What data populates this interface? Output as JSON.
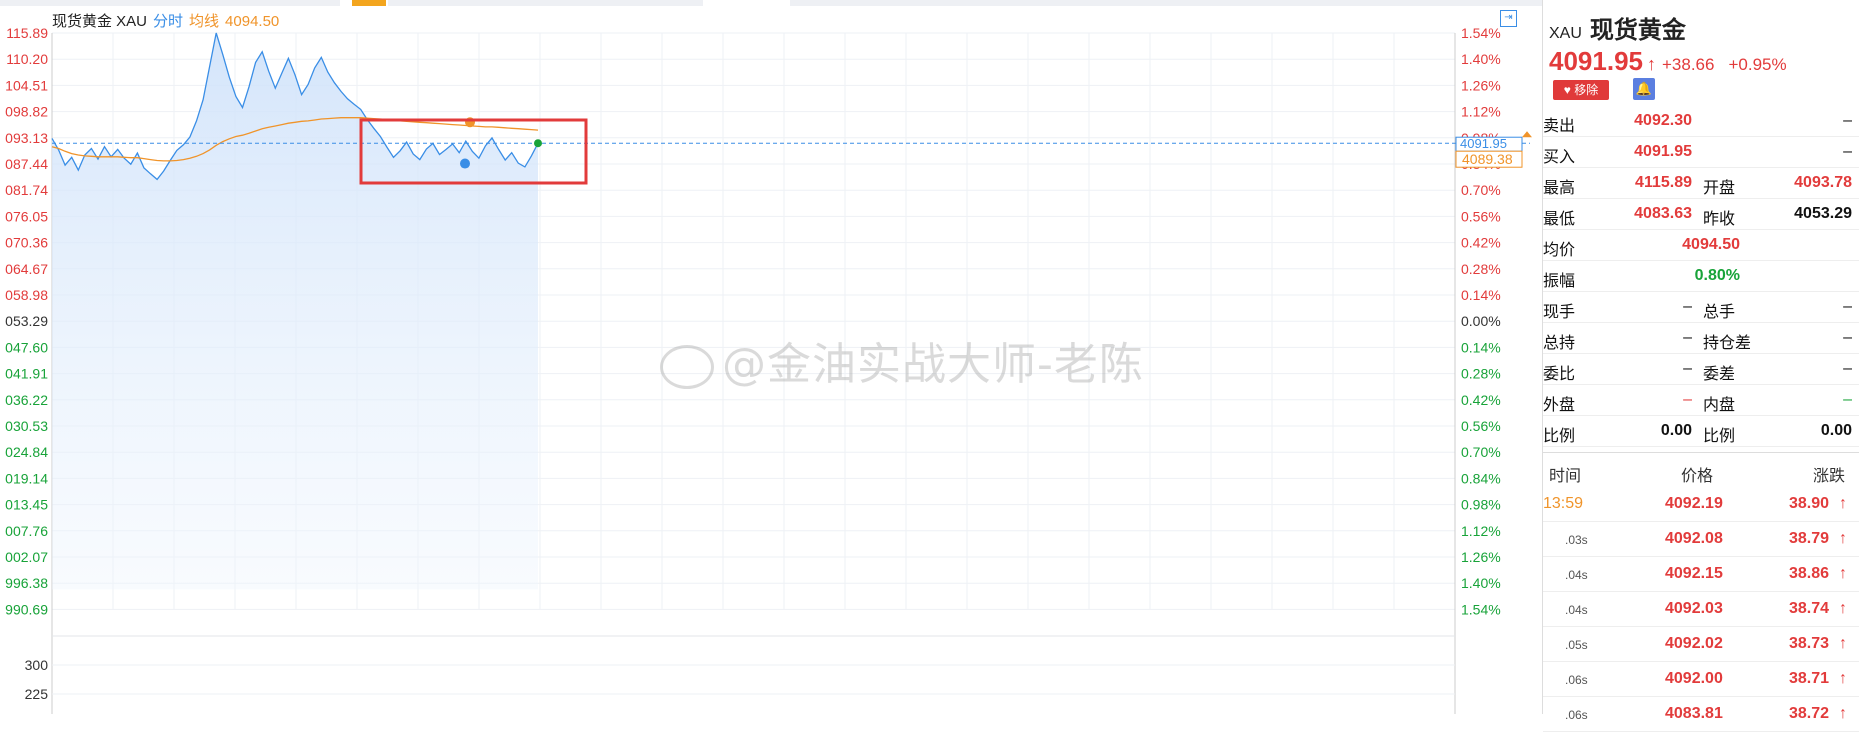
{
  "header": {
    "title": "现货黄金 XAU",
    "mode": "分时",
    "ma_label": "均线",
    "ma_value": "4094.50"
  },
  "chart_data": {
    "type": "line",
    "y_labels_left": [
      "115.89",
      "110.20",
      "104.51",
      "098.82",
      "093.13",
      "087.44",
      "081.74",
      "076.05",
      "070.36",
      "064.67",
      "058.98",
      "053.29",
      "047.60",
      "041.91",
      "036.22",
      "030.53",
      "024.84",
      "019.14",
      "013.45",
      "007.76",
      "002.07",
      "996.38",
      "990.69"
    ],
    "y_labels_right": [
      "1.54%",
      "1.40%",
      "1.26%",
      "1.12%",
      "0.98%",
      "0.84%",
      "0.70%",
      "0.56%",
      "0.42%",
      "0.28%",
      "0.14%",
      "0.00%",
      "0.14%",
      "0.28%",
      "0.42%",
      "0.56%",
      "0.70%",
      "0.84%",
      "0.98%",
      "1.12%",
      "1.26%",
      "1.40%",
      "1.54%"
    ],
    "volume_ticks": [
      "300",
      "225"
    ],
    "ylim": [
      3990.69,
      4115.89
    ],
    "current_price_tag": "4091.95",
    "avg_price_tag": "4089.38",
    "series": [
      {
        "values": [
          4093.0,
          4090.5,
          4087.2,
          4088.9,
          4086.1,
          4089.4,
          4090.8,
          4088.5,
          4091.2,
          4089.0,
          4090.6,
          4088.7,
          4087.4,
          4089.8,
          4086.6,
          4085.3,
          4084.1,
          4085.9,
          4088.2,
          4090.4,
          4091.6,
          4093.3,
          4096.8,
          4101.4,
          4108.6,
          4115.9,
          4111.2,
          4106.3,
          4102.1,
          4099.7,
          4104.2,
          4109.5,
          4111.8,
          4107.6,
          4103.9,
          4107.2,
          4110.4,
          4106.8,
          4102.5,
          4104.7,
          4108.3,
          4110.6,
          4107.4,
          4105.1,
          4103.2,
          4101.6,
          4100.4,
          4099.3,
          4097.1,
          4095.2,
          4093.4,
          4091.1,
          4088.9,
          4090.3,
          4092.2,
          4089.6,
          4088.4,
          4090.7,
          4091.9,
          4089.5,
          4090.6,
          4091.8,
          4089.9,
          4092.4,
          4090.2,
          4088.7,
          4091.4,
          4093.1,
          4090.6,
          4088.3,
          4089.9,
          4087.6,
          4086.8,
          4089.2,
          4091.95
        ]
      },
      {
        "values": [
          4091.2,
          4090.8,
          4090.2,
          4089.7,
          4089.4,
          4089.2,
          4089.1,
          4089.0,
          4089.0,
          4089.0,
          4089.0,
          4088.9,
          4088.8,
          4088.8,
          4088.6,
          4088.4,
          4088.2,
          4088.1,
          4088.1,
          4088.2,
          4088.4,
          4088.7,
          4089.1,
          4089.7,
          4090.5,
          4091.5,
          4092.3,
          4092.9,
          4093.4,
          4093.7,
          4094.1,
          4094.6,
          4095.1,
          4095.4,
          4095.7,
          4096.0,
          4096.3,
          4096.5,
          4096.7,
          4096.8,
          4097.0,
          4097.2,
          4097.3,
          4097.4,
          4097.5,
          4097.5,
          4097.5,
          4097.5,
          4097.4,
          4097.3,
          4097.2,
          4097.1,
          4096.9,
          4096.8,
          4096.7,
          4096.6,
          4096.5,
          4096.4,
          4096.3,
          4096.2,
          4096.1,
          4096.0,
          4095.9,
          4095.8,
          4095.7,
          4095.6,
          4095.5,
          4095.5,
          4095.4,
          4095.3,
          4095.2,
          4095.1,
          4095.0,
          4094.9,
          4094.8
        ]
      }
    ]
  },
  "colors": {
    "up": "#e23b3b",
    "down": "#18a339",
    "price_line": "#3a8ee6",
    "avg_line": "#f0942a",
    "highlight_box": "#e23b3b"
  },
  "watermark": "@金油实战大师-老陈",
  "panel": {
    "code": "XAU",
    "name": "现货黄金",
    "price": "4091.95",
    "change": "+38.66",
    "change_pct": "+0.95%",
    "remove_label": "移除",
    "quotes": [
      {
        "l1": "卖出",
        "v1": "4092.30",
        "l2": "",
        "v2": "–"
      },
      {
        "l1": "买入",
        "v1": "4091.95",
        "l2": "",
        "v2": "–"
      },
      {
        "l1": "最高",
        "v1": "4115.89",
        "l2": "开盘",
        "v2": "4093.78"
      },
      {
        "l1": "最低",
        "v1": "4083.63",
        "l2": "昨收",
        "v2": "4053.29"
      },
      {
        "l1": "均价",
        "v1": "4094.50",
        "l2": "",
        "v2": ""
      },
      {
        "l1": "振幅",
        "v1": "0.80%",
        "l2": "",
        "v2": ""
      },
      {
        "l1": "现手",
        "v1": "–",
        "l2": "总手",
        "v2": "–"
      },
      {
        "l1": "总持",
        "v1": "–",
        "l2": "持仓差",
        "v2": "–"
      },
      {
        "l1": "委比",
        "v1": "–",
        "l2": "委差",
        "v2": "–"
      },
      {
        "l1": "外盘",
        "v1": "–",
        "l2": "内盘",
        "v2": "–"
      },
      {
        "l1": "比例",
        "v1": "0.00",
        "l2": "比例",
        "v2": "0.00"
      }
    ],
    "trades_head": {
      "time": "时间",
      "price": "价格",
      "change": "涨跌"
    },
    "trades": [
      {
        "time": "13:59",
        "price": "4092.19",
        "chg": "38.90"
      },
      {
        "time": ".03s",
        "price": "4092.08",
        "chg": "38.79"
      },
      {
        "time": ".04s",
        "price": "4092.15",
        "chg": "38.86"
      },
      {
        "time": ".04s",
        "price": "4092.03",
        "chg": "38.74"
      },
      {
        "time": ".05s",
        "price": "4092.02",
        "chg": "38.73"
      },
      {
        "time": ".06s",
        "price": "4092.00",
        "chg": "38.71"
      },
      {
        "time": ".06s",
        "price": "4083.81",
        "chg": "38.72"
      }
    ]
  }
}
